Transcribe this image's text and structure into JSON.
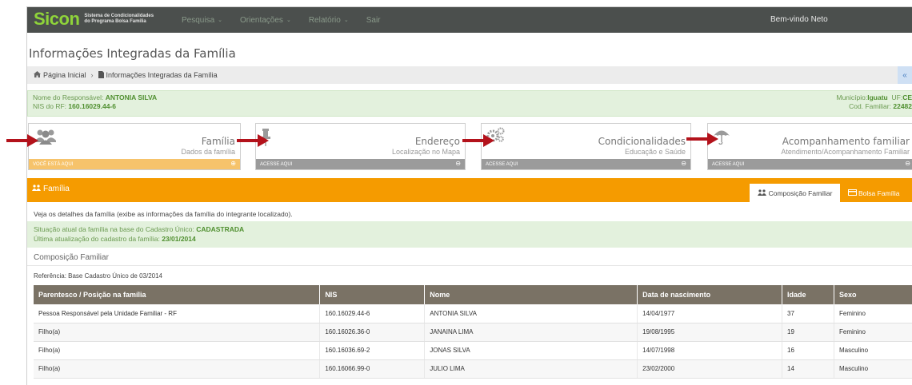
{
  "topnav": {
    "logo": "Sicon",
    "logo_sub_line1": "Sistema de Condicionalidades",
    "logo_sub_line2": "do Programa Bolsa Família",
    "items": [
      {
        "label": "Pesquisa",
        "has_caret": true
      },
      {
        "label": "Orientações",
        "has_caret": true
      },
      {
        "label": "Relatório",
        "has_caret": true
      },
      {
        "label": "Sair",
        "has_caret": false
      }
    ],
    "welcome": "Bem-vindo Neto"
  },
  "page_title": "Informações Integradas da Família",
  "breadcrumb": {
    "home": "Página Inicial",
    "current": "Informações Integradas da Família",
    "collapse_icon": "«"
  },
  "responsavel": {
    "nome_label": "Nome do Responsável:",
    "nome": "ANTONIA SILVA",
    "nis_label": "NIS do RF:",
    "nis": "160.16029.44-6",
    "municipio_label": "Município:",
    "municipio": "Iguatu",
    "uf_label": "UF:",
    "uf": "CE",
    "cod_label": "Cod. Familiar:",
    "cod": "22482"
  },
  "cards": [
    {
      "title": "Família",
      "subtitle": "Dados da família",
      "footer": "VOCÊ ESTÁ AQUI",
      "icon": "users-icon"
    },
    {
      "title": "Endereço",
      "subtitle": "Localização no Mapa",
      "footer": "ACESSE AQUI",
      "icon": "pin-icon"
    },
    {
      "title": "Condicionalidades",
      "subtitle": "Educação e Saúde",
      "footer": "ACESSE AQUI",
      "icon": "gears-icon"
    },
    {
      "title": "Acompanhamento familiar",
      "subtitle": "Atendimento/Acompanhamento Familiar",
      "footer": "ACESSE AQUI",
      "icon": "umbrella-icon"
    }
  ],
  "familia_section": {
    "title": "Família",
    "tab_composicao": "Composição Familiar",
    "tab_bolsa": "Bolsa Família",
    "description": "Veja os detalhes da família (exibe as informações da família do integrante localizado).",
    "situacao_label": "Situação atual da família na base do Cadastro Único:",
    "situacao": "CADASTRADA",
    "atualizacao_label": "Última atualização do cadastro da família:",
    "atualizacao": "23/01/2014",
    "composicao_title": "Composição Familiar",
    "referencia": "Referência: Base Cadastro Único de 03/2014"
  },
  "table": {
    "headers": [
      "Parentesco / Posição na família",
      "NIS",
      "Nome",
      "Data de nascimento",
      "Idade",
      "Sexo"
    ],
    "rows": [
      [
        "Pessoa Responsável pela Unidade Familiar - RF",
        "160.16029.44-6",
        "ANTONIA SILVA",
        "14/04/1977",
        "37",
        "Feminino"
      ],
      [
        "Filho(a)",
        "160.16026.36-0",
        "JANAINA LIMA",
        "19/08/1995",
        "19",
        "Feminino"
      ],
      [
        "Filho(a)",
        "160.16036.69-2",
        "JONAS SILVA",
        "14/07/1998",
        "16",
        "Masculino"
      ],
      [
        "Filho(a)",
        "160.16066.99-0",
        "JULIO LIMA",
        "23/02/2000",
        "14",
        "Masculino"
      ]
    ]
  },
  "colors": {
    "nav_bg": "#4b4f4d",
    "brand_green": "#8fd43a",
    "orange": "#f59b00",
    "info_green_bg": "#e3f1dd",
    "table_header": "#7a7265",
    "arrow_red": "#b3121b"
  }
}
